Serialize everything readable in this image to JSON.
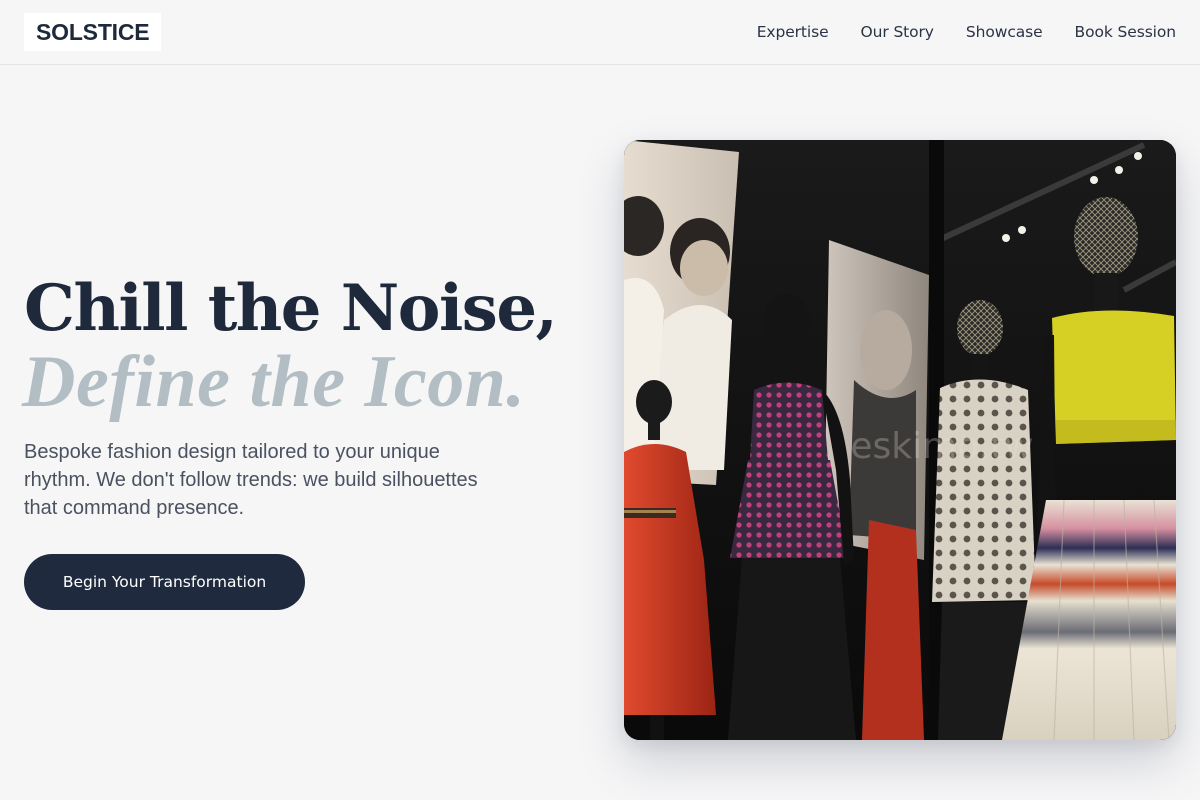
{
  "header": {
    "logo": "SOLSTICE",
    "nav": [
      "Expertise",
      "Our Story",
      "Showcase",
      "Book Session"
    ]
  },
  "hero": {
    "title": "Chill the Noise,",
    "subtitle": "Define the Icon.",
    "description": "Bespoke fashion design tailored to your unique rhythm. We don't follow trends: we build silhouettes that command presence.",
    "cta_label": "Begin Your Transformation"
  },
  "image": {
    "watermark": "eskimo.tw",
    "colors": {
      "red_coat": "#c8321e",
      "yellow_top": "#d4cc24",
      "cta_bg": "#1f2a3e",
      "subtitle": "#b2bec3"
    }
  }
}
